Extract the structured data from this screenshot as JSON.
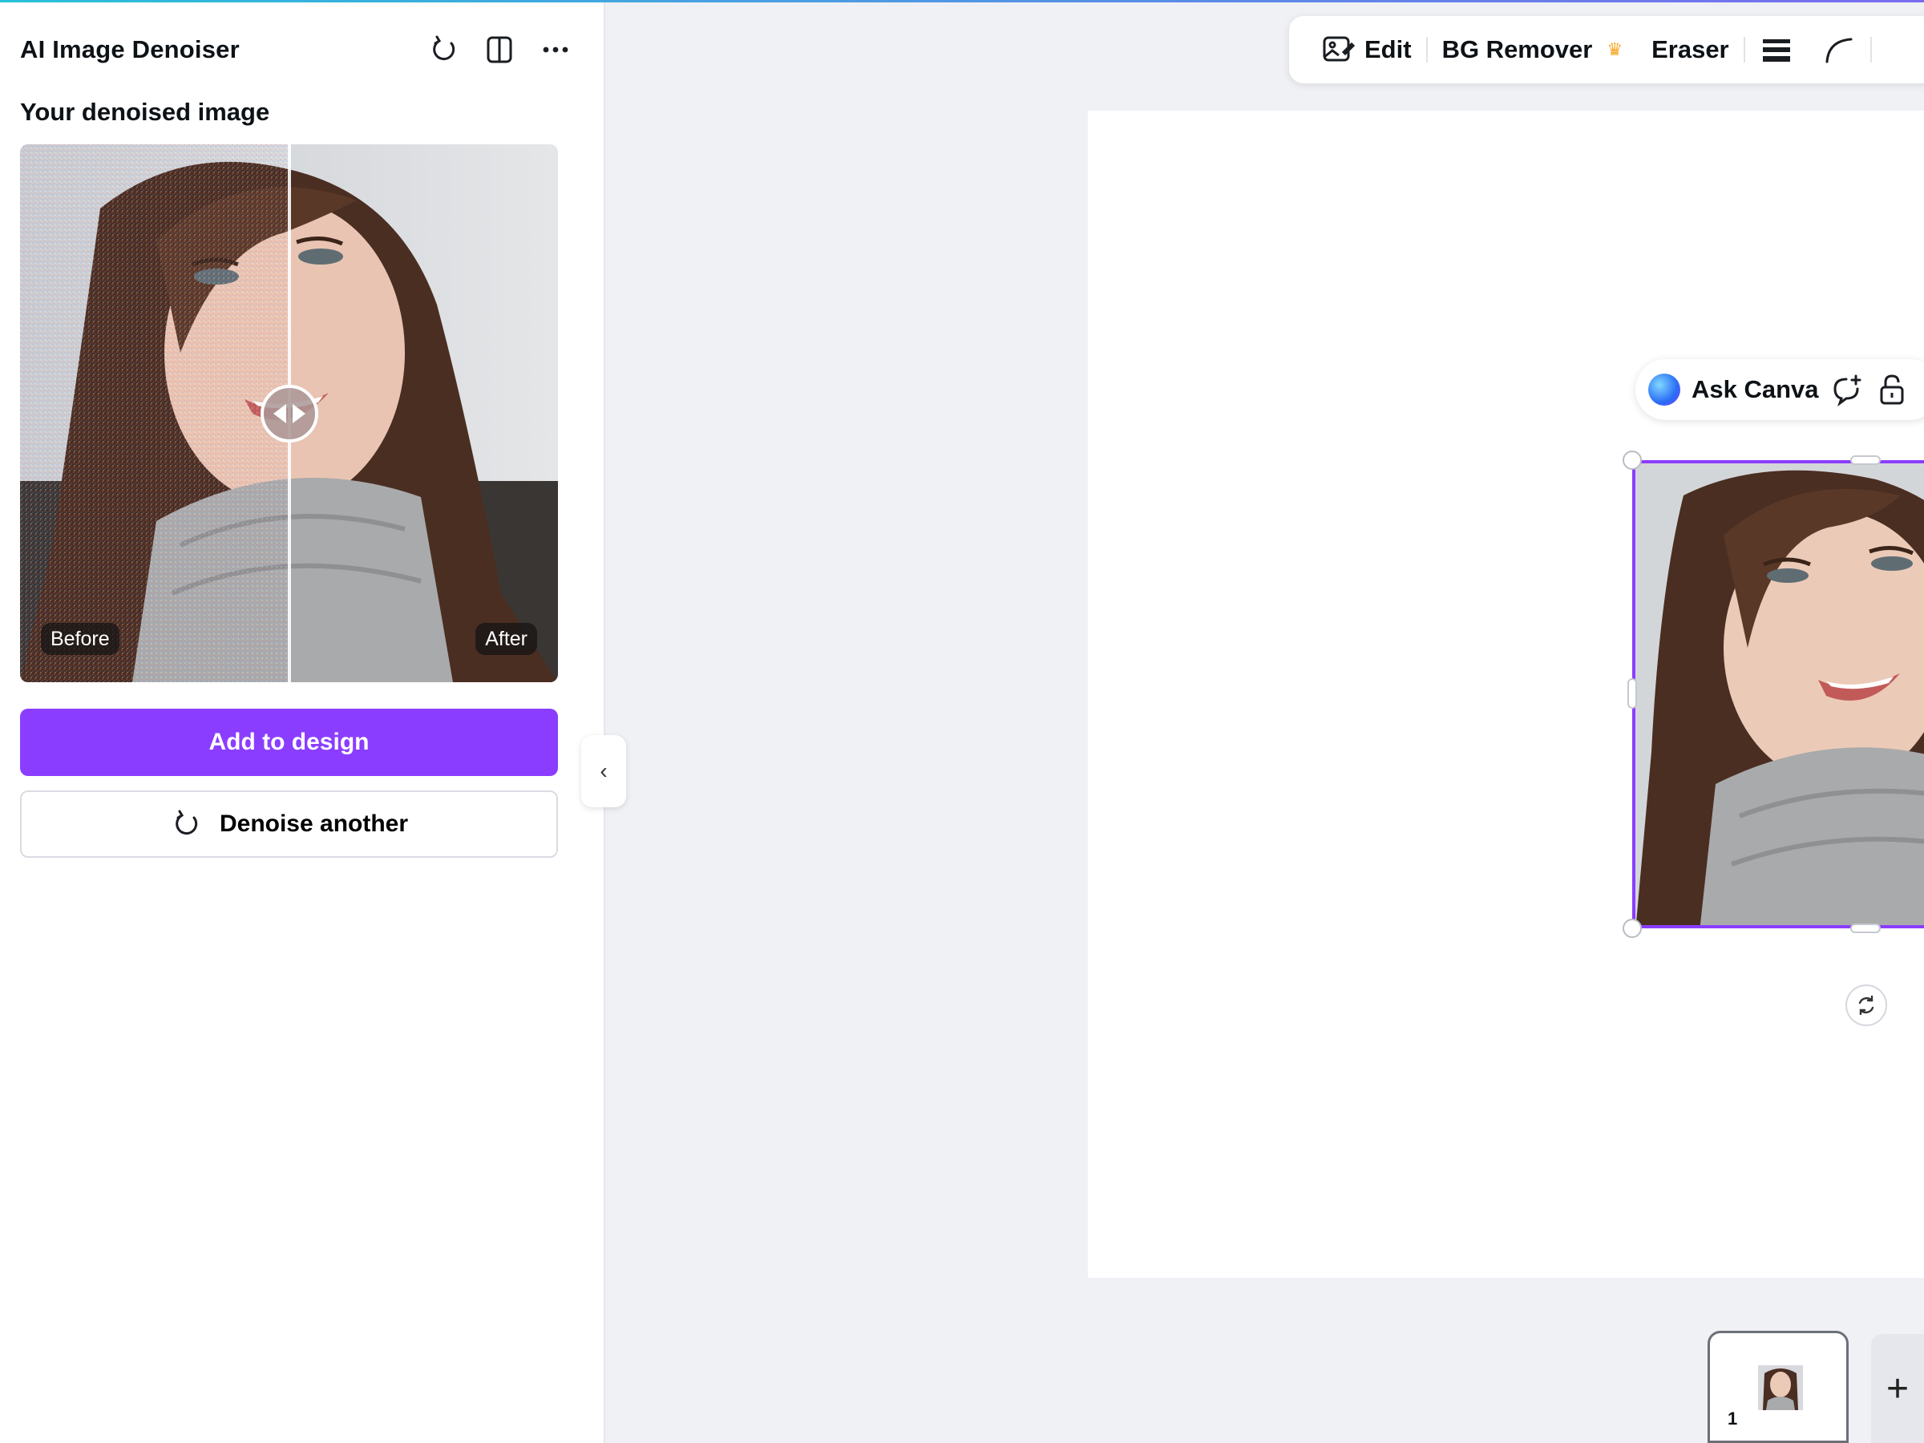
{
  "panel": {
    "title": "AI Image Denoiser",
    "section_label": "Your denoised image",
    "compare": {
      "before_label": "Before",
      "after_label": "After"
    },
    "add_button": "Add to design",
    "denoise_button": "Denoise another",
    "collapse_glyph": "‹"
  },
  "toolbar": {
    "edit": "Edit",
    "bg_remover": "BG Remover",
    "bg_remover_badge": "♛",
    "eraser": "Eraser"
  },
  "ask_canva": {
    "label": "Ask Canva"
  },
  "pages": {
    "current": "1",
    "add_glyph": "+"
  },
  "colors": {
    "accent": "#8b3dff",
    "badge": "#f5a623"
  }
}
